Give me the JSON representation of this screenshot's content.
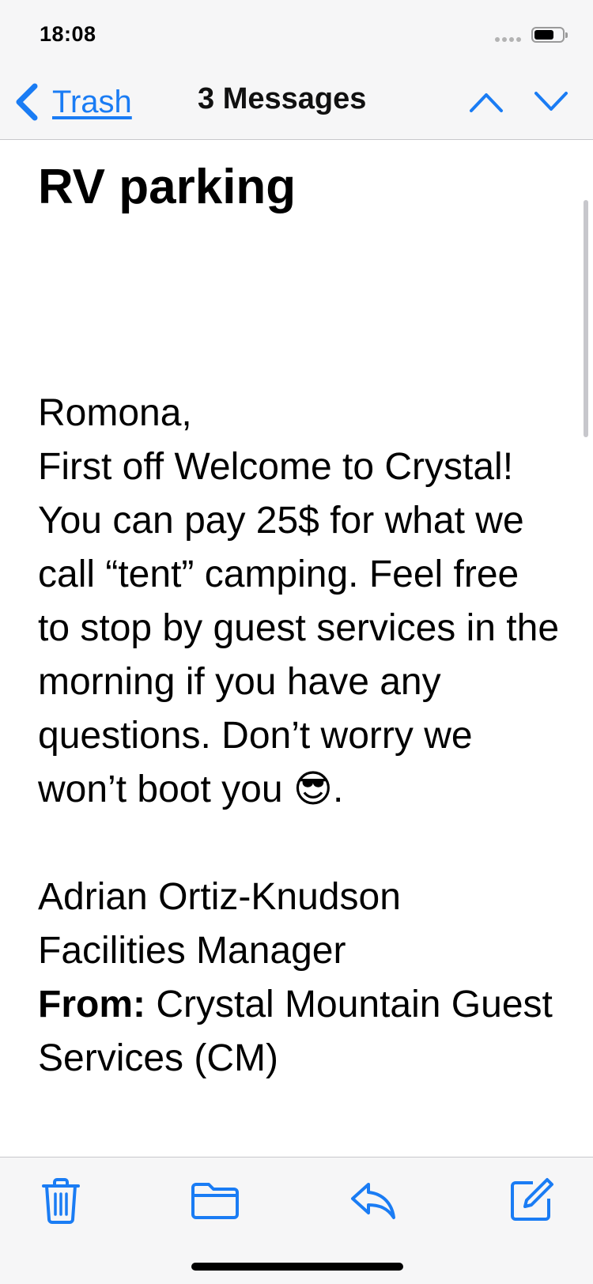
{
  "status_bar": {
    "time": "18:08"
  },
  "nav": {
    "back_label": "Trash",
    "title": "3 Messages"
  },
  "message": {
    "subject": "RV parking",
    "greeting": "Romona,",
    "paragraph": "First off Welcome to Crystal! You can pay 25$ for what we call “tent” camping. Feel free to stop by guest services in the morning if you have any questions. Don’t worry we won’t boot you",
    "emoji": "😎",
    "paragraph_end": ".",
    "signature_name": "Adrian Ortiz-Knudson",
    "signature_title": "Facilities Manager",
    "from_label": "From:",
    "from_value": "Crystal Mountain Guest Services (CM)"
  },
  "toolbar": {
    "trash_icon": "trash-icon",
    "folder_icon": "folder-icon",
    "reply_icon": "reply-icon",
    "compose_icon": "compose-icon"
  },
  "colors": {
    "accent": "#1a7cf4",
    "chrome_bg": "#f6f6f7"
  }
}
